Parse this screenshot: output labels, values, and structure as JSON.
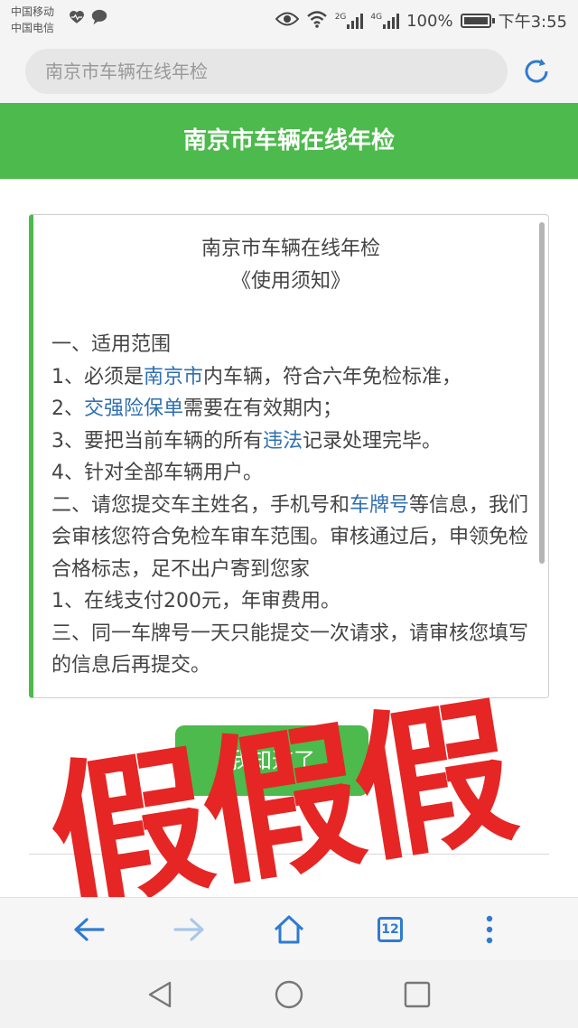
{
  "status_bar": {
    "carrier_1": "中国移动",
    "carrier_2": "中国电信",
    "battery_text": "100%",
    "battery_level": 1.0,
    "time": "下午3:55",
    "signal_2g": "2G",
    "signal_4g": "4G"
  },
  "address_bar": {
    "text": "南京市车辆在线年检",
    "reload_icon": "reload-icon"
  },
  "header": {
    "title": "南京市车辆在线年检"
  },
  "notice": {
    "title": "南京市车辆在线年检",
    "subtitle": "《使用须知》",
    "sec1_heading": "一、适用范围",
    "item1_pre": "1、必须是",
    "item1_link": "南京市",
    "item1_post": "内车辆，符合六年免检标准，",
    "item2_pre": "2、",
    "item2_link": "交强险保单",
    "item2_post": "需要在有效期内；",
    "item3_pre": "3、要把当前车辆的所有",
    "item3_link": "违法",
    "item3_post": "记录处理完毕。",
    "item4": "4、针对全部车辆用户。",
    "sec2_pre": "二、请您提交车主姓名，手机号和",
    "sec2_link": "车牌号",
    "sec2_post": "等信息，我们会审核您符合免检车审车范围。审核通过后，申领免检合格标志，足不出户寄到您家",
    "sec2_item1": "1、在线支付200元，年审费用。",
    "sec3": "三、同一车牌号一天只能提交一次请求，请审核您填写的信息后再提交。"
  },
  "ok_button": {
    "label": "我知道了"
  },
  "stamp": {
    "text": "假假假",
    "color": "#e52624"
  },
  "toolbar": {
    "tab_count": "12",
    "back_icon": "back-arrow-icon",
    "forward_icon": "forward-arrow-icon",
    "home_icon": "home-icon",
    "menu_icon": "more-vertical-icon"
  },
  "colors": {
    "accent_green": "#4cba4c",
    "link_blue": "#2f6fb0",
    "toolbar_blue": "#2f7bd0"
  }
}
